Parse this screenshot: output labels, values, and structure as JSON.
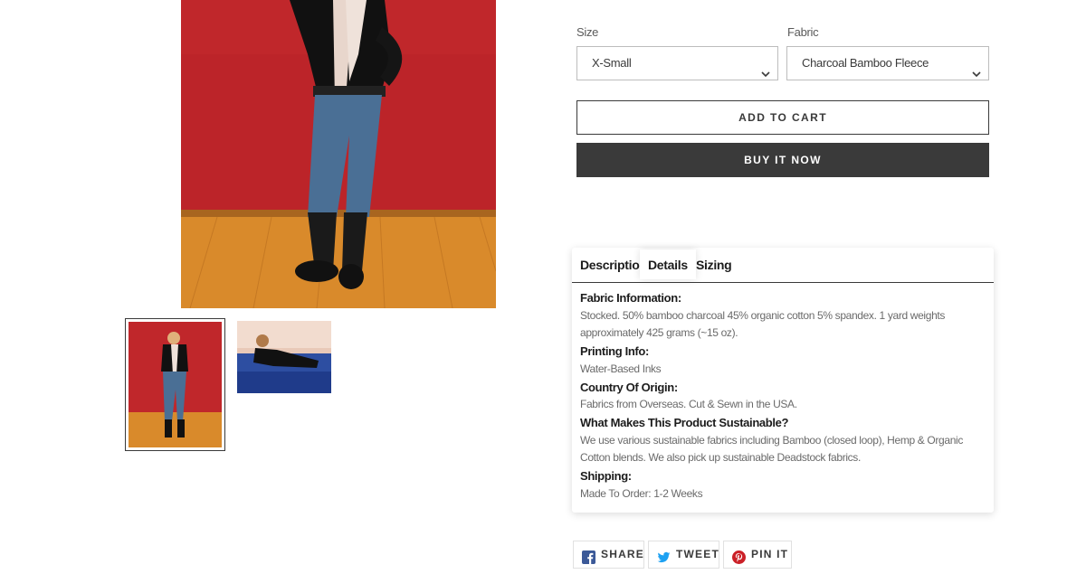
{
  "variants": {
    "size": {
      "label": "Size",
      "value": "X-Small"
    },
    "fabric": {
      "label": "Fabric",
      "value": "Charcoal Bamboo Fleece"
    }
  },
  "actions": {
    "add_to_cart": "ADD TO CART",
    "buy_now": "BUY IT NOW"
  },
  "tabs": {
    "items": [
      {
        "label": "Description"
      },
      {
        "label": "Details",
        "active": true
      },
      {
        "label": "Sizing"
      }
    ]
  },
  "details": [
    {
      "heading": "Fabric Information:",
      "text": "Stocked. 50% bamboo charcoal 45% organic cotton 5% spandex. 1 yard weights approximately 425 grams (~15 oz)."
    },
    {
      "heading": "Printing Info:",
      "text": "Water-Based Inks"
    },
    {
      "heading": "Country Of Origin:",
      "text": "Fabrics from Overseas. Cut & Sewn in the USA."
    },
    {
      "heading": "What Makes This Product Sustainable?",
      "text": "We use various sustainable fabrics including Bamboo (closed loop), Hemp & Organic Cotton blends. We also pick up sustainable Deadstock fabrics."
    },
    {
      "heading": "Shipping:",
      "text": "Made To Order: 1-2 Weeks"
    }
  ],
  "social": {
    "share": "SHARE",
    "tweet": "TWEET",
    "pin": "PIN IT"
  },
  "colors": {
    "dark": "#3a3a3a",
    "wall": "#c0272b",
    "floor": "#d98a2b",
    "facebook": "#3b5998",
    "twitter": "#1da1f2",
    "pinterest": "#cb2027"
  },
  "icons": [
    "chevron-down-icon",
    "facebook-icon",
    "twitter-icon",
    "pinterest-icon"
  ]
}
